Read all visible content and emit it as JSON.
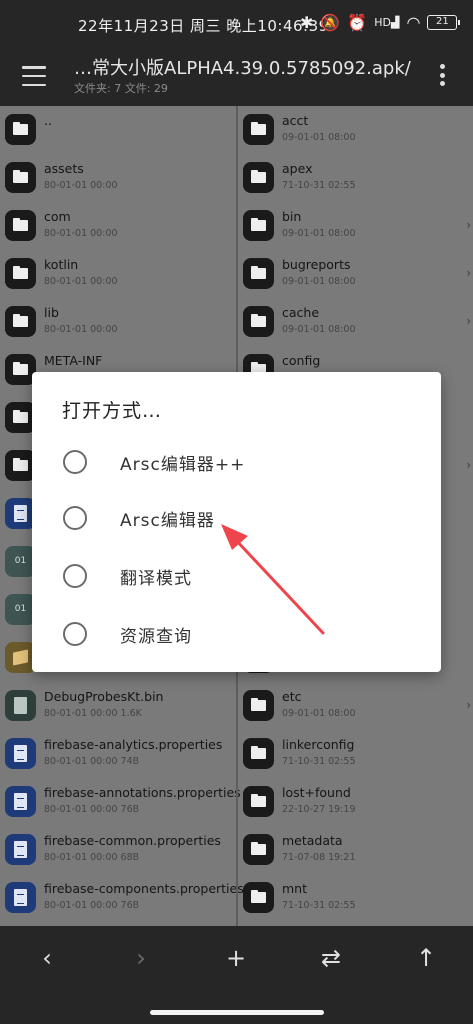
{
  "status": {
    "datetime": "22年11月23日 周三 晚上10:46:39",
    "battery": "21",
    "icons": [
      "bluetooth-icon",
      "alarm-off-icon",
      "alarm-icon",
      "hd-signal-icon",
      "wifi-icon",
      "battery-icon"
    ]
  },
  "appbar": {
    "title": "…常大小版ALPHA4.39.0.5785092.apk/",
    "subtitle": "文件夹: 7  文件: 29"
  },
  "left_panel": {
    "rows": [
      {
        "name": "..",
        "meta": "",
        "icon": "folder"
      },
      {
        "name": "assets",
        "meta": "80-01-01 00:00",
        "icon": "folder"
      },
      {
        "name": "com",
        "meta": "80-01-01 00:00",
        "icon": "folder"
      },
      {
        "name": "kotlin",
        "meta": "80-01-01 00:00",
        "icon": "folder"
      },
      {
        "name": "lib",
        "meta": "80-01-01 00:00",
        "icon": "folder"
      },
      {
        "name": "META-INF",
        "meta": "",
        "icon": "folder"
      },
      {
        "name": "",
        "meta": "",
        "icon": "folder"
      },
      {
        "name": "",
        "meta": "",
        "icon": "folder"
      },
      {
        "name": "",
        "meta": "",
        "icon": "doc"
      },
      {
        "name": "",
        "meta": "",
        "icon": "binary"
      },
      {
        "name": "",
        "meta": "",
        "icon": "binary"
      },
      {
        "name": "",
        "meta": "",
        "icon": "stack"
      },
      {
        "name": "DebugProbesKt.bin",
        "meta": "80-01-01 00:00  1.6K",
        "icon": "bin"
      },
      {
        "name": "firebase-analytics.properties",
        "meta": "80-01-01 00:00  74B",
        "icon": "doc"
      },
      {
        "name": "firebase-annotations.properties",
        "meta": "80-01-01 00:00  76B",
        "icon": "doc"
      },
      {
        "name": "firebase-common.properties",
        "meta": "80-01-01 00:00  68B",
        "icon": "doc"
      },
      {
        "name": "firebase-components.properties",
        "meta": "80-01-01 00:00  76B",
        "icon": "doc"
      }
    ]
  },
  "right_panel": {
    "rows": [
      {
        "name": "acct",
        "meta": "09-01-01 08:00",
        "icon": "folder",
        "chevron": false
      },
      {
        "name": "apex",
        "meta": "71-10-31 02:55",
        "icon": "folder",
        "chevron": false
      },
      {
        "name": "bin",
        "meta": "09-01-01 08:00",
        "icon": "folder",
        "chevron": true
      },
      {
        "name": "bugreports",
        "meta": "09-01-01 08:00",
        "icon": "folder",
        "chevron": true
      },
      {
        "name": "cache",
        "meta": "09-01-01 08:00",
        "icon": "folder",
        "chevron": true
      },
      {
        "name": "config",
        "meta": "",
        "icon": "folder",
        "chevron": false
      },
      {
        "name": "",
        "meta": "",
        "icon": "folder",
        "chevron": false
      },
      {
        "name": "",
        "meta": "",
        "icon": "folder",
        "chevron": true
      },
      {
        "name": "",
        "meta": "",
        "icon": "folder",
        "chevron": false
      },
      {
        "name": "",
        "meta": "",
        "icon": "folder",
        "chevron": false
      },
      {
        "name": "",
        "meta": "",
        "icon": "folder",
        "chevron": false
      },
      {
        "name": "",
        "meta": "",
        "icon": "folder",
        "chevron": false
      },
      {
        "name": "etc",
        "meta": "09-01-01 08:00",
        "icon": "folder",
        "chevron": true
      },
      {
        "name": "linkerconfig",
        "meta": "71-10-31 02:55",
        "icon": "folder",
        "chevron": false
      },
      {
        "name": "lost+found",
        "meta": "22-10-27 19:19",
        "icon": "folder",
        "chevron": false
      },
      {
        "name": "metadata",
        "meta": "71-07-08 19:21",
        "icon": "folder",
        "chevron": false
      },
      {
        "name": "mnt",
        "meta": "71-10-31 02:55",
        "icon": "folder",
        "chevron": false
      }
    ]
  },
  "dialog": {
    "title": "打开方式…",
    "options": [
      {
        "label": "Arsc编辑器++"
      },
      {
        "label": "Arsc编辑器"
      },
      {
        "label": "翻译模式"
      },
      {
        "label": "资源查询"
      }
    ]
  },
  "annotation_color": "#f0444c",
  "bottom_nav": {
    "back_icon": "‹",
    "forward_icon": "›",
    "add_icon": "+",
    "swap_icon": "⇄",
    "up_icon": "↑"
  }
}
